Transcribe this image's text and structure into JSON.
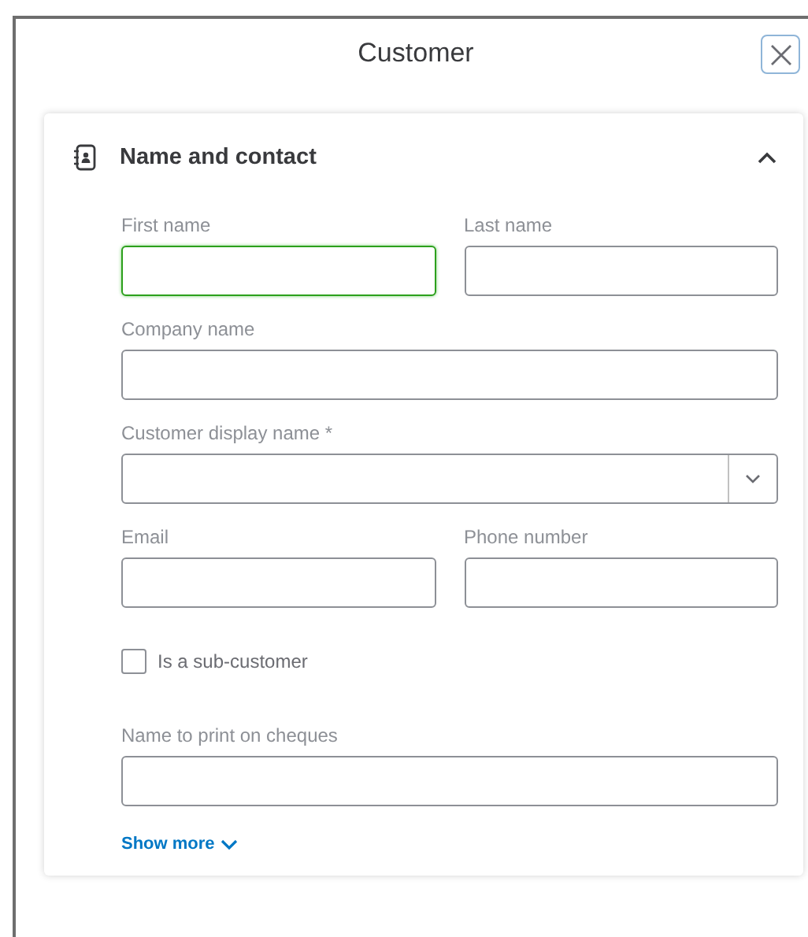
{
  "window": {
    "title": "Customer"
  },
  "section": {
    "title": "Name and contact",
    "expanded": true
  },
  "rows": [
    {
      "fields": [
        {
          "kind": "text",
          "label": "First name",
          "focused": true
        },
        {
          "kind": "text",
          "label": "Last name",
          "focused": false
        }
      ]
    },
    {
      "fields": [
        {
          "kind": "text",
          "label": "Company name",
          "focused": false
        }
      ]
    },
    {
      "fields": [
        {
          "kind": "select",
          "label": "Customer display name *",
          "focused": false
        }
      ]
    },
    {
      "fields": [
        {
          "kind": "text",
          "label": "Email",
          "focused": false
        },
        {
          "kind": "text",
          "label": "Phone number",
          "focused": false
        }
      ]
    },
    {
      "fields": [
        {
          "kind": "checkbox",
          "label": "Is a sub-customer",
          "checked": false
        }
      ]
    },
    {
      "fields": [
        {
          "kind": "text",
          "label": "Name to print on cheques",
          "focused": false
        }
      ]
    }
  ],
  "show_more": "Show more"
}
